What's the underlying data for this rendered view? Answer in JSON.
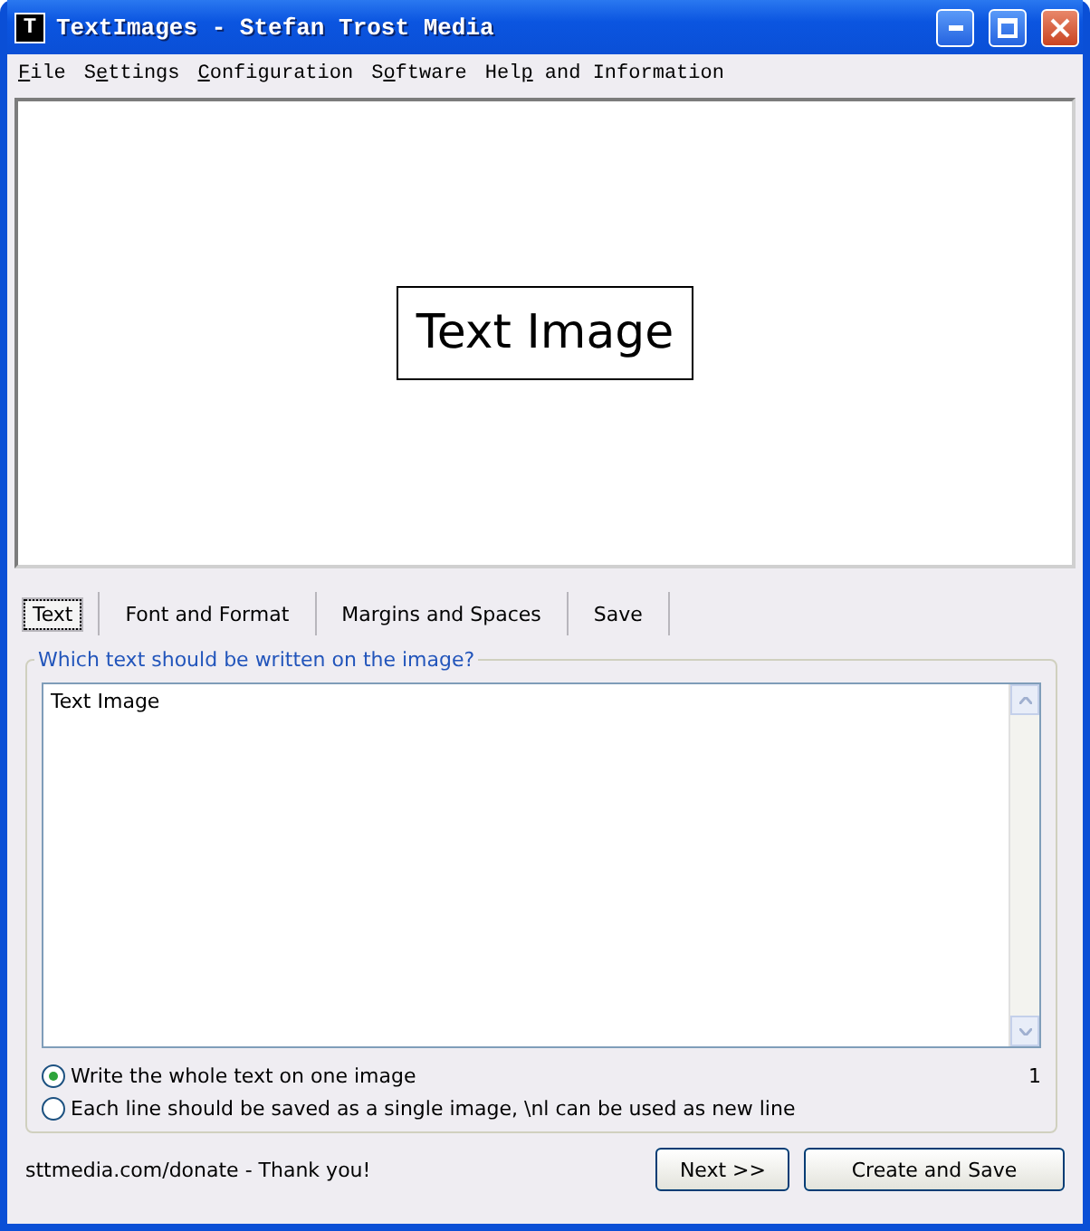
{
  "window": {
    "title": "TextImages - Stefan Trost Media",
    "icon": "T"
  },
  "menu": [
    {
      "parts": [
        {
          "text": "F",
          "underlined": true
        },
        {
          "text": "ile",
          "underlined": false
        }
      ]
    },
    {
      "parts": [
        {
          "text": "S",
          "underlined": false
        },
        {
          "text": "e",
          "underlined": true
        },
        {
          "text": "ttings",
          "underlined": false
        }
      ]
    },
    {
      "parts": [
        {
          "text": "C",
          "underlined": true
        },
        {
          "text": "onfiguration",
          "underlined": false
        }
      ]
    },
    {
      "parts": [
        {
          "text": "S",
          "underlined": false
        },
        {
          "text": "o",
          "underlined": true
        },
        {
          "text": "ftware",
          "underlined": false
        }
      ]
    },
    {
      "parts": [
        {
          "text": "Hel",
          "underlined": false
        },
        {
          "text": "p",
          "underlined": true
        },
        {
          "text": " and Information",
          "underlined": false
        }
      ]
    }
  ],
  "preview": {
    "text": "Text Image"
  },
  "tabs": [
    {
      "label": "Text",
      "selected": true
    },
    {
      "label": "Font and Format",
      "selected": false
    },
    {
      "label": "Margins and Spaces",
      "selected": false
    },
    {
      "label": "Save",
      "selected": false
    }
  ],
  "group": {
    "title": "Which text should be written on the image?",
    "value": "Text Image",
    "line_count": "1",
    "options": [
      {
        "label": "Write the whole text on one image",
        "selected": true
      },
      {
        "label": "Each line should be saved as a single image, \\nl can be used as new line",
        "selected": false
      }
    ]
  },
  "footer": {
    "note": "sttmedia.com/donate - Thank you!",
    "buttons": [
      "Next >>",
      "Create and Save"
    ]
  }
}
